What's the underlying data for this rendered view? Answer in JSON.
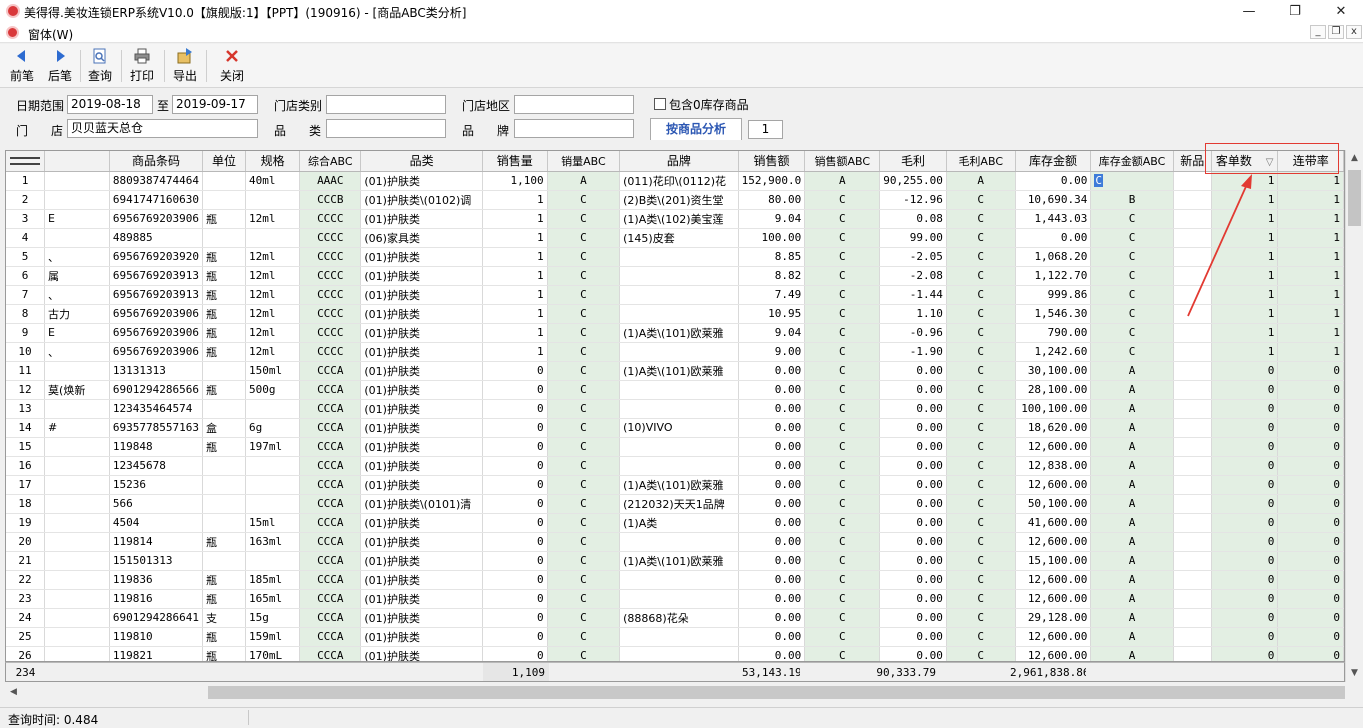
{
  "window": {
    "title": "美得得.美妆连锁ERP系统V10.0【旗舰版:1】【PPT】(190916) - [商品ABC类分析]",
    "minimize": "—",
    "maximize": "❐",
    "close": "✕"
  },
  "menu": {
    "form_label": "窗体(W)",
    "mdi_min": "_",
    "mdi_restore": "❐",
    "mdi_close": "x"
  },
  "toolbar": {
    "prev": "前笔",
    "next": "后笔",
    "query": "查询",
    "print": "打印",
    "export": "导出",
    "close": "关闭"
  },
  "filter": {
    "date_range_label": "日期范围",
    "date_from": "2019-08-18",
    "to_label": "至",
    "date_to": "2019-09-17",
    "store_type_label": "门店类别",
    "store_type_value": "",
    "store_region_label": "门店地区",
    "store_region_value": "",
    "include_zero_label": "包含0库存商品",
    "store_label_a": "门",
    "store_label_b": "店",
    "store_value": "贝贝蓝天总仓",
    "category_label_a": "品",
    "category_label_b": "类",
    "category_value": "",
    "brand_label_a": "品",
    "brand_label_b": "牌",
    "brand_value": "",
    "analysis_tab": "按商品分析",
    "page_value": "1"
  },
  "grid": {
    "columns": {
      "name": "",
      "barcode": "商品条码",
      "unit": "单位",
      "spec": "规格",
      "combined_abc": "综合ABC",
      "category": "品类",
      "sales_qty": "销售量",
      "sales_qty_abc": "销量ABC",
      "brand": "品牌",
      "sales_amount": "销售额",
      "sales_amount_abc": "销售额ABC",
      "gross_profit": "毛利",
      "gross_profit_abc": "毛利ABC",
      "stock_amount": "库存金额",
      "stock_amount_abc": "库存金额ABC",
      "new_item": "新品",
      "order_count": "客单数",
      "order_count_sort": "▽",
      "attach_rate": "连带率"
    },
    "rows": [
      {
        "no": "1",
        "name": "",
        "barcode": "8809387474464",
        "unit": "",
        "spec": "40ml",
        "combined_abc": "AAAC",
        "category": "(01)护肤类",
        "sales_qty": "1,100",
        "sales_qty_abc": "A",
        "brand": "(011)花印\\(0112)花",
        "sales_amount": "152,900.0",
        "sales_amount_abc": "A",
        "gross_profit": "90,255.00",
        "gross_profit_abc": "A",
        "stock_amount": "0.00",
        "stock_amount_abc": "C",
        "new_item": "",
        "order_count": "1",
        "attach_rate": "1"
      },
      {
        "no": "2",
        "name": "",
        "barcode": "6941747160630",
        "unit": "",
        "spec": "",
        "combined_abc": "CCCB",
        "category": "(01)护肤类\\(0102)调",
        "sales_qty": "1",
        "sales_qty_abc": "C",
        "brand": "(2)B类\\(201)资生堂",
        "sales_amount": "80.00",
        "sales_amount_abc": "C",
        "gross_profit": "-12.96",
        "gross_profit_abc": "C",
        "stock_amount": "10,690.34",
        "stock_amount_abc": "B",
        "new_item": "",
        "order_count": "1",
        "attach_rate": "1"
      },
      {
        "no": "3",
        "name": "E",
        "barcode": "6956769203906",
        "unit": "瓶",
        "spec": "12ml",
        "combined_abc": "CCCC",
        "category": "(01)护肤类",
        "sales_qty": "1",
        "sales_qty_abc": "C",
        "brand": "(1)A类\\(102)美宝莲",
        "sales_amount": "9.04",
        "sales_amount_abc": "C",
        "gross_profit": "0.08",
        "gross_profit_abc": "C",
        "stock_amount": "1,443.03",
        "stock_amount_abc": "C",
        "new_item": "",
        "order_count": "1",
        "attach_rate": "1"
      },
      {
        "no": "4",
        "name": "",
        "barcode": "489885",
        "unit": "",
        "spec": "",
        "combined_abc": "CCCC",
        "category": "(06)家具类",
        "sales_qty": "1",
        "sales_qty_abc": "C",
        "brand": "(145)皮套",
        "sales_amount": "100.00",
        "sales_amount_abc": "C",
        "gross_profit": "99.00",
        "gross_profit_abc": "C",
        "stock_amount": "0.00",
        "stock_amount_abc": "C",
        "new_item": "",
        "order_count": "1",
        "attach_rate": "1"
      },
      {
        "no": "5",
        "name": "、",
        "barcode": "6956769203920",
        "unit": "瓶",
        "spec": "12ml",
        "combined_abc": "CCCC",
        "category": "(01)护肤类",
        "sales_qty": "1",
        "sales_qty_abc": "C",
        "brand": "",
        "sales_amount": "8.85",
        "sales_amount_abc": "C",
        "gross_profit": "-2.05",
        "gross_profit_abc": "C",
        "stock_amount": "1,068.20",
        "stock_amount_abc": "C",
        "new_item": "",
        "order_count": "1",
        "attach_rate": "1"
      },
      {
        "no": "6",
        "name": "属",
        "barcode": "6956769203913",
        "unit": "瓶",
        "spec": "12ml",
        "combined_abc": "CCCC",
        "category": "(01)护肤类",
        "sales_qty": "1",
        "sales_qty_abc": "C",
        "brand": "",
        "sales_amount": "8.82",
        "sales_amount_abc": "C",
        "gross_profit": "-2.08",
        "gross_profit_abc": "C",
        "stock_amount": "1,122.70",
        "stock_amount_abc": "C",
        "new_item": "",
        "order_count": "1",
        "attach_rate": "1"
      },
      {
        "no": "7",
        "name": "、",
        "barcode": "6956769203913",
        "unit": "瓶",
        "spec": "12ml",
        "combined_abc": "CCCC",
        "category": "(01)护肤类",
        "sales_qty": "1",
        "sales_qty_abc": "C",
        "brand": "",
        "sales_amount": "7.49",
        "sales_amount_abc": "C",
        "gross_profit": "-1.44",
        "gross_profit_abc": "C",
        "stock_amount": "999.86",
        "stock_amount_abc": "C",
        "new_item": "",
        "order_count": "1",
        "attach_rate": "1"
      },
      {
        "no": "8",
        "name": "古力",
        "barcode": "6956769203906",
        "unit": "瓶",
        "spec": "12ml",
        "combined_abc": "CCCC",
        "category": "(01)护肤类",
        "sales_qty": "1",
        "sales_qty_abc": "C",
        "brand": "",
        "sales_amount": "10.95",
        "sales_amount_abc": "C",
        "gross_profit": "1.10",
        "gross_profit_abc": "C",
        "stock_amount": "1,546.30",
        "stock_amount_abc": "C",
        "new_item": "",
        "order_count": "1",
        "attach_rate": "1"
      },
      {
        "no": "9",
        "name": "E",
        "barcode": "6956769203906",
        "unit": "瓶",
        "spec": "12ml",
        "combined_abc": "CCCC",
        "category": "(01)护肤类",
        "sales_qty": "1",
        "sales_qty_abc": "C",
        "brand": "(1)A类\\(101)欧莱雅",
        "sales_amount": "9.04",
        "sales_amount_abc": "C",
        "gross_profit": "-0.96",
        "gross_profit_abc": "C",
        "stock_amount": "790.00",
        "stock_amount_abc": "C",
        "new_item": "",
        "order_count": "1",
        "attach_rate": "1"
      },
      {
        "no": "10",
        "name": "、",
        "barcode": "6956769203906",
        "unit": "瓶",
        "spec": "12ml",
        "combined_abc": "CCCC",
        "category": "(01)护肤类",
        "sales_qty": "1",
        "sales_qty_abc": "C",
        "brand": "",
        "sales_amount": "9.00",
        "sales_amount_abc": "C",
        "gross_profit": "-1.90",
        "gross_profit_abc": "C",
        "stock_amount": "1,242.60",
        "stock_amount_abc": "C",
        "new_item": "",
        "order_count": "1",
        "attach_rate": "1"
      },
      {
        "no": "11",
        "name": "",
        "barcode": "13131313",
        "unit": "",
        "spec": "150ml",
        "combined_abc": "CCCA",
        "category": "(01)护肤类",
        "sales_qty": "0",
        "sales_qty_abc": "C",
        "brand": "(1)A类\\(101)欧莱雅",
        "sales_amount": "0.00",
        "sales_amount_abc": "C",
        "gross_profit": "0.00",
        "gross_profit_abc": "C",
        "stock_amount": "30,100.00",
        "stock_amount_abc": "A",
        "new_item": "",
        "order_count": "0",
        "attach_rate": "0"
      },
      {
        "no": "12",
        "name": "莫(焕新",
        "barcode": "6901294286566",
        "unit": "瓶",
        "spec": "500g",
        "combined_abc": "CCCA",
        "category": "(01)护肤类",
        "sales_qty": "0",
        "sales_qty_abc": "C",
        "brand": "",
        "sales_amount": "0.00",
        "sales_amount_abc": "C",
        "gross_profit": "0.00",
        "gross_profit_abc": "C",
        "stock_amount": "28,100.00",
        "stock_amount_abc": "A",
        "new_item": "",
        "order_count": "0",
        "attach_rate": "0"
      },
      {
        "no": "13",
        "name": "",
        "barcode": "123435464574",
        "unit": "",
        "spec": "",
        "combined_abc": "CCCA",
        "category": "(01)护肤类",
        "sales_qty": "0",
        "sales_qty_abc": "C",
        "brand": "",
        "sales_amount": "0.00",
        "sales_amount_abc": "C",
        "gross_profit": "0.00",
        "gross_profit_abc": "C",
        "stock_amount": "100,100.00",
        "stock_amount_abc": "A",
        "new_item": "",
        "order_count": "0",
        "attach_rate": "0"
      },
      {
        "no": "14",
        "name": "#",
        "barcode": "6935778557163",
        "unit": "盒",
        "spec": "6g",
        "combined_abc": "CCCA",
        "category": "(01)护肤类",
        "sales_qty": "0",
        "sales_qty_abc": "C",
        "brand": "(10)VIVO",
        "sales_amount": "0.00",
        "sales_amount_abc": "C",
        "gross_profit": "0.00",
        "gross_profit_abc": "C",
        "stock_amount": "18,620.00",
        "stock_amount_abc": "A",
        "new_item": "",
        "order_count": "0",
        "attach_rate": "0"
      },
      {
        "no": "15",
        "name": "",
        "barcode": "119848",
        "unit": "瓶",
        "spec": "197ml",
        "combined_abc": "CCCA",
        "category": "(01)护肤类",
        "sales_qty": "0",
        "sales_qty_abc": "C",
        "brand": "",
        "sales_amount": "0.00",
        "sales_amount_abc": "C",
        "gross_profit": "0.00",
        "gross_profit_abc": "C",
        "stock_amount": "12,600.00",
        "stock_amount_abc": "A",
        "new_item": "",
        "order_count": "0",
        "attach_rate": "0"
      },
      {
        "no": "16",
        "name": "",
        "barcode": "12345678",
        "unit": "",
        "spec": "",
        "combined_abc": "CCCA",
        "category": "(01)护肤类",
        "sales_qty": "0",
        "sales_qty_abc": "C",
        "brand": "",
        "sales_amount": "0.00",
        "sales_amount_abc": "C",
        "gross_profit": "0.00",
        "gross_profit_abc": "C",
        "stock_amount": "12,838.00",
        "stock_amount_abc": "A",
        "new_item": "",
        "order_count": "0",
        "attach_rate": "0"
      },
      {
        "no": "17",
        "name": "",
        "barcode": "15236",
        "unit": "",
        "spec": "",
        "combined_abc": "CCCA",
        "category": "(01)护肤类",
        "sales_qty": "0",
        "sales_qty_abc": "C",
        "brand": "(1)A类\\(101)欧莱雅",
        "sales_amount": "0.00",
        "sales_amount_abc": "C",
        "gross_profit": "0.00",
        "gross_profit_abc": "C",
        "stock_amount": "12,600.00",
        "stock_amount_abc": "A",
        "new_item": "",
        "order_count": "0",
        "attach_rate": "0"
      },
      {
        "no": "18",
        "name": "",
        "barcode": "566",
        "unit": "",
        "spec": "",
        "combined_abc": "CCCA",
        "category": "(01)护肤类\\(0101)清",
        "sales_qty": "0",
        "sales_qty_abc": "C",
        "brand": "(212032)天天1品牌",
        "sales_amount": "0.00",
        "sales_amount_abc": "C",
        "gross_profit": "0.00",
        "gross_profit_abc": "C",
        "stock_amount": "50,100.00",
        "stock_amount_abc": "A",
        "new_item": "",
        "order_count": "0",
        "attach_rate": "0"
      },
      {
        "no": "19",
        "name": "",
        "barcode": "4504",
        "unit": "",
        "spec": "15ml",
        "combined_abc": "CCCA",
        "category": "(01)护肤类",
        "sales_qty": "0",
        "sales_qty_abc": "C",
        "brand": "(1)A类",
        "sales_amount": "0.00",
        "sales_amount_abc": "C",
        "gross_profit": "0.00",
        "gross_profit_abc": "C",
        "stock_amount": "41,600.00",
        "stock_amount_abc": "A",
        "new_item": "",
        "order_count": "0",
        "attach_rate": "0"
      },
      {
        "no": "20",
        "name": "",
        "barcode": "119814",
        "unit": "瓶",
        "spec": "163ml",
        "combined_abc": "CCCA",
        "category": "(01)护肤类",
        "sales_qty": "0",
        "sales_qty_abc": "C",
        "brand": "",
        "sales_amount": "0.00",
        "sales_amount_abc": "C",
        "gross_profit": "0.00",
        "gross_profit_abc": "C",
        "stock_amount": "12,600.00",
        "stock_amount_abc": "A",
        "new_item": "",
        "order_count": "0",
        "attach_rate": "0"
      },
      {
        "no": "21",
        "name": "",
        "barcode": "151501313",
        "unit": "",
        "spec": "",
        "combined_abc": "CCCA",
        "category": "(01)护肤类",
        "sales_qty": "0",
        "sales_qty_abc": "C",
        "brand": "(1)A类\\(101)欧莱雅",
        "sales_amount": "0.00",
        "sales_amount_abc": "C",
        "gross_profit": "0.00",
        "gross_profit_abc": "C",
        "stock_amount": "15,100.00",
        "stock_amount_abc": "A",
        "new_item": "",
        "order_count": "0",
        "attach_rate": "0"
      },
      {
        "no": "22",
        "name": "",
        "barcode": "119836",
        "unit": "瓶",
        "spec": "185ml",
        "combined_abc": "CCCA",
        "category": "(01)护肤类",
        "sales_qty": "0",
        "sales_qty_abc": "C",
        "brand": "",
        "sales_amount": "0.00",
        "sales_amount_abc": "C",
        "gross_profit": "0.00",
        "gross_profit_abc": "C",
        "stock_amount": "12,600.00",
        "stock_amount_abc": "A",
        "new_item": "",
        "order_count": "0",
        "attach_rate": "0"
      },
      {
        "no": "23",
        "name": "",
        "barcode": "119816",
        "unit": "瓶",
        "spec": "165ml",
        "combined_abc": "CCCA",
        "category": "(01)护肤类",
        "sales_qty": "0",
        "sales_qty_abc": "C",
        "brand": "",
        "sales_amount": "0.00",
        "sales_amount_abc": "C",
        "gross_profit": "0.00",
        "gross_profit_abc": "C",
        "stock_amount": "12,600.00",
        "stock_amount_abc": "A",
        "new_item": "",
        "order_count": "0",
        "attach_rate": "0"
      },
      {
        "no": "24",
        "name": "",
        "barcode": "6901294286641",
        "unit": "支",
        "spec": "15g",
        "combined_abc": "CCCA",
        "category": "(01)护肤类",
        "sales_qty": "0",
        "sales_qty_abc": "C",
        "brand": "(88868)花朵",
        "sales_amount": "0.00",
        "sales_amount_abc": "C",
        "gross_profit": "0.00",
        "gross_profit_abc": "C",
        "stock_amount": "29,128.00",
        "stock_amount_abc": "A",
        "new_item": "",
        "order_count": "0",
        "attach_rate": "0"
      },
      {
        "no": "25",
        "name": "",
        "barcode": "119810",
        "unit": "瓶",
        "spec": "159ml",
        "combined_abc": "CCCA",
        "category": "(01)护肤类",
        "sales_qty": "0",
        "sales_qty_abc": "C",
        "brand": "",
        "sales_amount": "0.00",
        "sales_amount_abc": "C",
        "gross_profit": "0.00",
        "gross_profit_abc": "C",
        "stock_amount": "12,600.00",
        "stock_amount_abc": "A",
        "new_item": "",
        "order_count": "0",
        "attach_rate": "0"
      },
      {
        "no": "26",
        "name": "",
        "barcode": "119821",
        "unit": "瓶",
        "spec": "170mL",
        "combined_abc": "CCCA",
        "category": "(01)护肤类",
        "sales_qty": "0",
        "sales_qty_abc": "C",
        "brand": "",
        "sales_amount": "0.00",
        "sales_amount_abc": "C",
        "gross_profit": "0.00",
        "gross_profit_abc": "C",
        "stock_amount": "12,600.00",
        "stock_amount_abc": "A",
        "new_item": "",
        "order_count": "0",
        "attach_rate": "0"
      }
    ],
    "footer": {
      "row_count": "234",
      "sales_qty_total": "1,109",
      "sales_amount_total": "53,143.19",
      "gross_profit_total": "90,333.79",
      "stock_amount_total": "2,961,838.86"
    }
  },
  "status": {
    "query_time": "查询时间: 0.484"
  },
  "colors": {
    "highlight": "#e23a32",
    "abc_column_bg": "#e3efe3",
    "tab_text": "#2c57b3",
    "selection": "#3d7bd9"
  }
}
